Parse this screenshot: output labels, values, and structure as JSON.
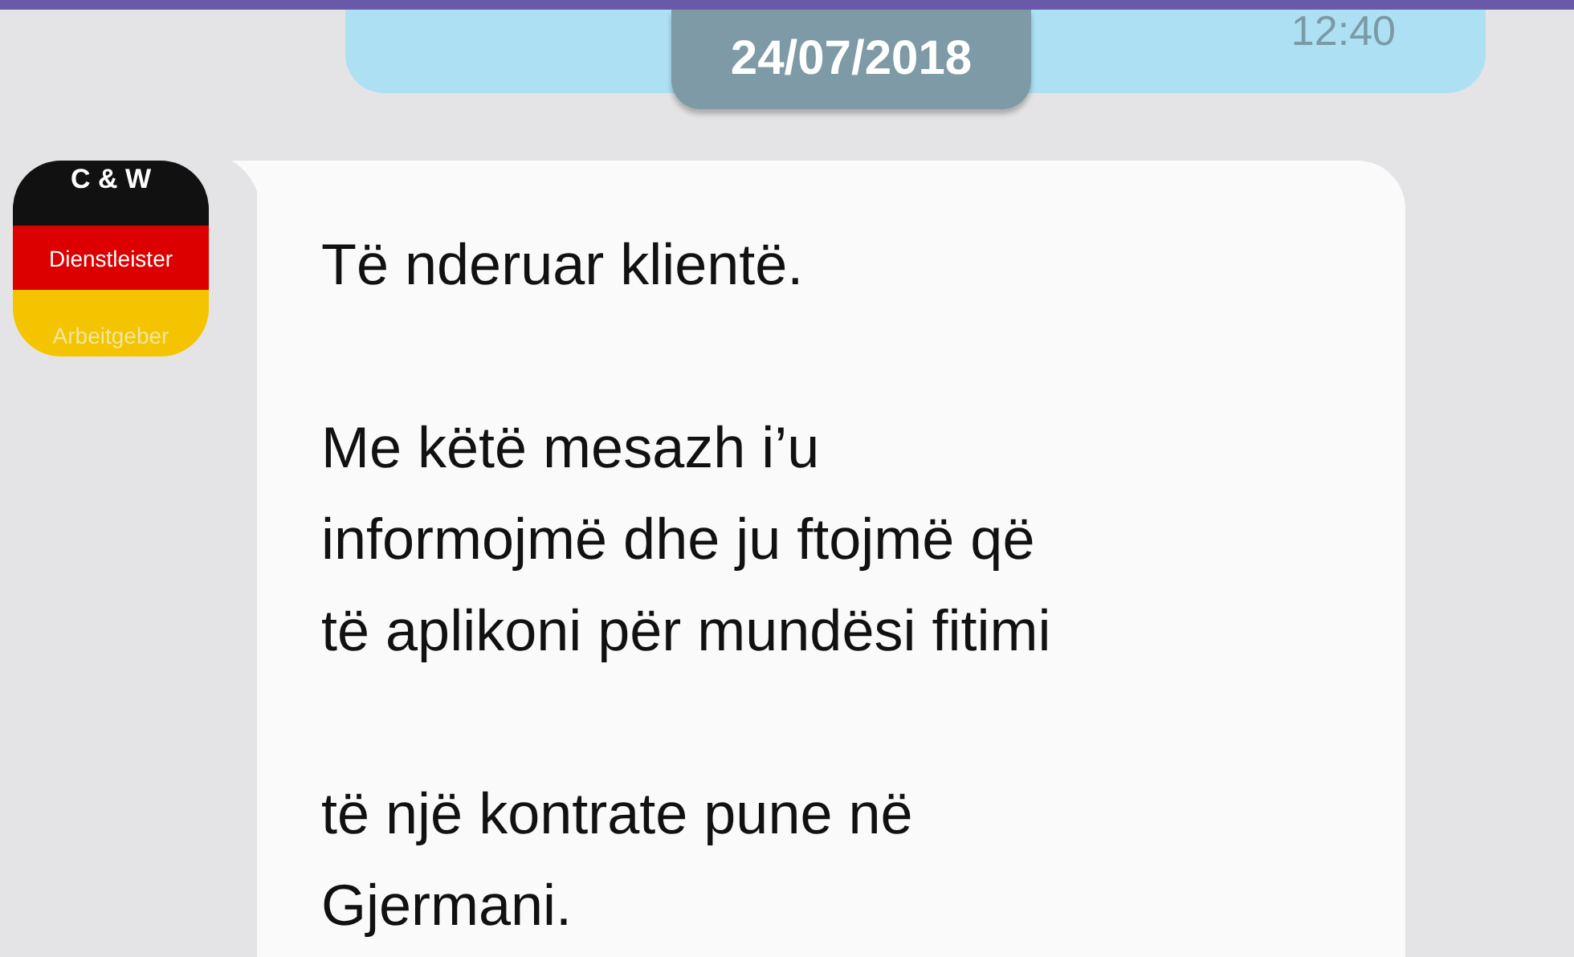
{
  "previous_message": {
    "time": "12:40"
  },
  "date_separator": "24/07/2018",
  "sender_avatar": {
    "lines": [
      "C & W",
      "Dienstleister",
      "Arbeitgeber"
    ]
  },
  "message": {
    "paragraphs": [
      [
        "Të nderuar klientë."
      ],
      [
        "Me këtë mesazh i’u",
        "informojmë dhe ju ftojmë që",
        "të aplikoni për mundësi fitimi"
      ],
      [
        "të një kontrate pune në",
        "Gjermani."
      ]
    ]
  }
}
